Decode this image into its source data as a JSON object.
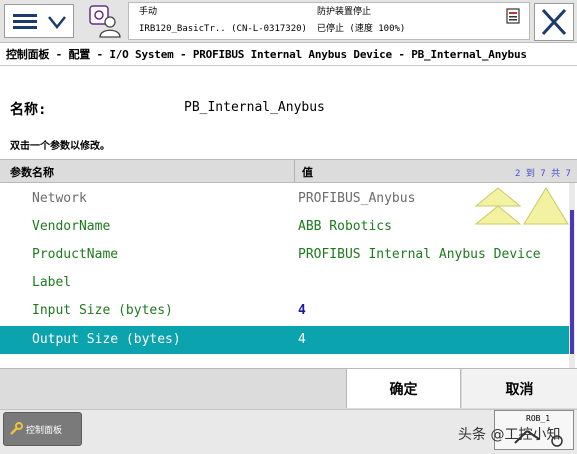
{
  "header": {
    "mode": "手动",
    "task": "IRB120_BasicTr.. (CN-L-0317320)",
    "state": "防护装置停止",
    "speed": "已停止 (速度 100%)"
  },
  "breadcrumb": "控制面板 - 配置 - I/O System - PROFIBUS Internal Anybus Device - PB_Internal_Anybus",
  "name_label": "名称:",
  "name_value": "PB_Internal_Anybus",
  "instruction": "双击一个参数以修改。",
  "table": {
    "col_name": "参数名称",
    "col_value": "值",
    "count": "2 到 7 共 7",
    "rows": [
      {
        "name": "Network",
        "value": "PROFIBUS_Anybus"
      },
      {
        "name": "VendorName",
        "value": "ABB Robotics"
      },
      {
        "name": "ProductName",
        "value": "PROFIBUS Internal Anybus Device"
      },
      {
        "name": "Label",
        "value": ""
      },
      {
        "name": "Input Size (bytes)",
        "value": "4"
      },
      {
        "name": "Output Size (bytes)",
        "value": "4"
      }
    ]
  },
  "buttons": {
    "ok": "确定",
    "cancel": "取消"
  },
  "taskbar": {
    "control_panel": "控制面板",
    "rob": "ROB_1",
    "watermark": "头条 @工控小知"
  },
  "colors": {
    "accent": "#0aa3ae",
    "param_green": "#1e7a1e",
    "menu_blue": "#1d3a6e"
  }
}
